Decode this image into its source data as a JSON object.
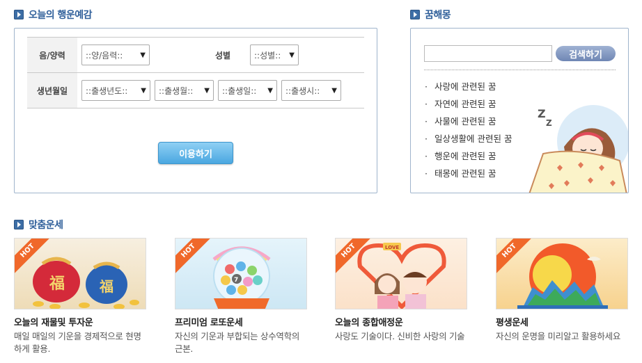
{
  "fortune": {
    "title": "오늘의 행운예감",
    "lunar_label": "음/양력",
    "lunar_select": "::양/음력::",
    "gender_label": "성별",
    "gender_select": "::성별::",
    "birth_label": "생년월일",
    "year_select": "::출생년도::",
    "month_select": "::출생월::",
    "day_select": "::출생일::",
    "hour_select": "::출생시::",
    "submit_label": "이용하기"
  },
  "dream": {
    "title": "꿈해몽",
    "search_value": "",
    "search_button": "검색하기",
    "items": [
      "사랑에 관련된 꿈",
      "자연에 관련된 꿈",
      "사물에 관련된 꿈",
      "일상생활에 관련된 꿈",
      "행운에 관련된 꿈",
      "태몽에 관련된 꿈"
    ]
  },
  "custom": {
    "title": "맞춤운세",
    "badge": "HOT",
    "cards": [
      {
        "title": "오늘의 재물및 투자운",
        "desc": "매일 매일의 기운을 경제적으로 현명하게 활용.",
        "image": "lucky-pouches",
        "ch1": "福",
        "ch2": "福"
      },
      {
        "title": "프리미엄 로또운세",
        "desc": "자신의 기운과 부합되는 상수역학의 근본.",
        "image": "lotto-machine",
        "ball": "7"
      },
      {
        "title": "오늘의 종합애정운",
        "desc": "사랑도 기술이다. 신비한 사랑의 기술",
        "image": "couple-heart",
        "sign": "LOVE"
      },
      {
        "title": "평생운세",
        "desc": "자신의 운명을 미리알고 활용하세요",
        "image": "sun-mountains"
      }
    ]
  },
  "colors": {
    "accent": "#3d6ea6",
    "hot": "#f0682a",
    "button": "#4aa7e0"
  }
}
